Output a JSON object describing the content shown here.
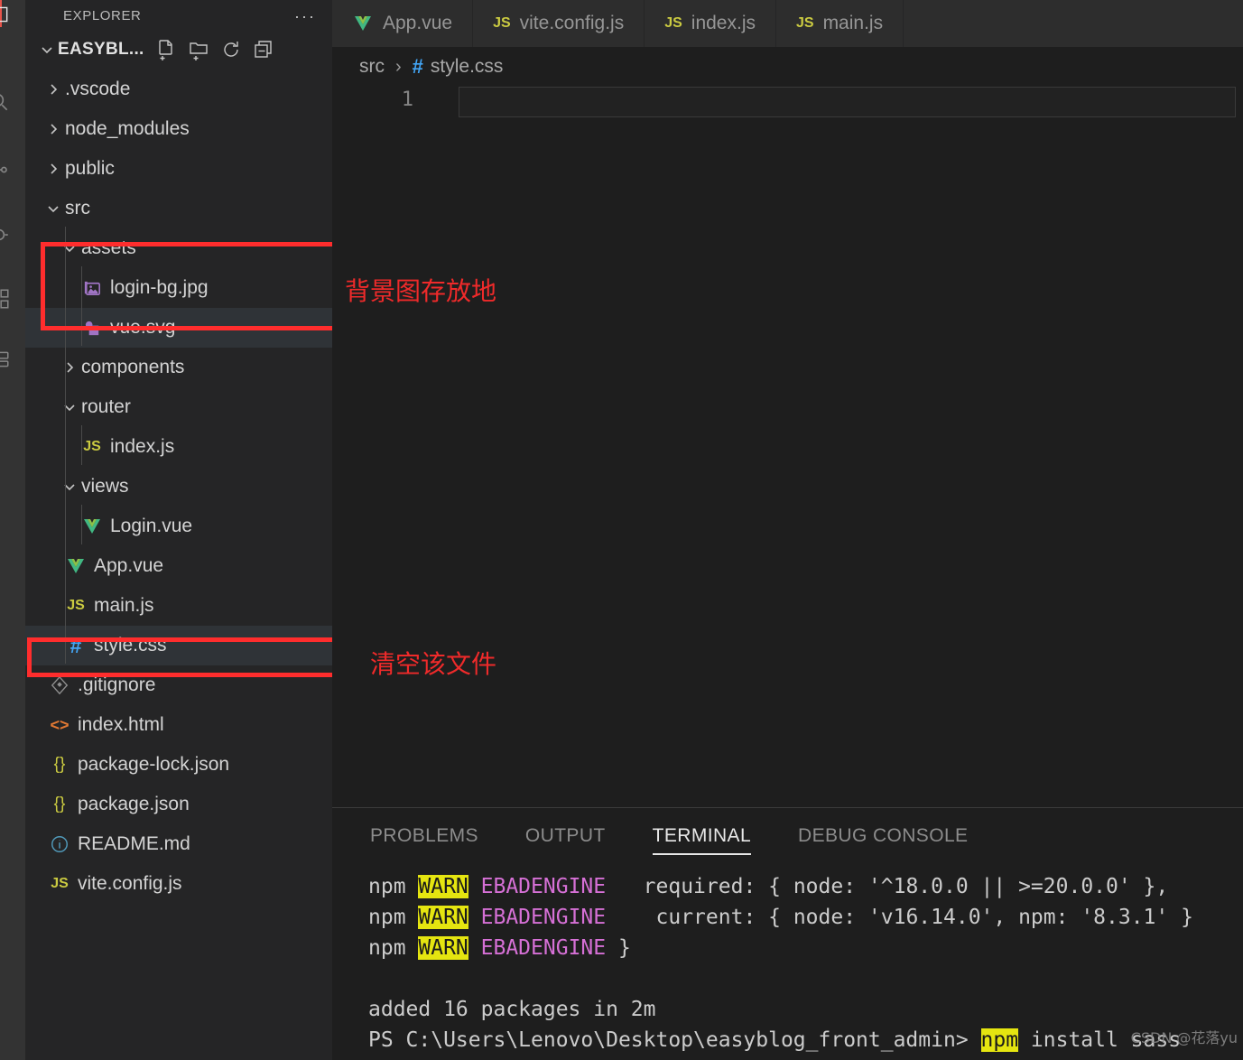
{
  "activity_bar": {
    "items": [
      {
        "name": "explorer-icon",
        "label": "Explorer"
      },
      {
        "name": "search-icon",
        "label": "Search"
      },
      {
        "name": "source-control-icon",
        "label": "Source Control"
      },
      {
        "name": "run-debug-icon",
        "label": "Run and Debug"
      },
      {
        "name": "extensions-icon",
        "label": "Extensions"
      },
      {
        "name": "remote-icon",
        "label": "Remote Explorer"
      }
    ],
    "accent_color": "#e7534a"
  },
  "sidebar": {
    "title": "EXPLORER",
    "more_actions": "···",
    "root_folder": "EASYBL...",
    "root_actions": [
      {
        "name": "new-file-icon",
        "label": "New File"
      },
      {
        "name": "new-folder-icon",
        "label": "New Folder"
      },
      {
        "name": "refresh-icon",
        "label": "Refresh Explorer"
      },
      {
        "name": "collapse-all-icon",
        "label": "Collapse Folders in Explorer"
      }
    ],
    "tree": [
      {
        "label": ".vscode",
        "kind": "folder",
        "state": "collapsed",
        "depth": 1,
        "icon": "chevron-right-icon"
      },
      {
        "label": "node_modules",
        "kind": "folder",
        "state": "collapsed",
        "depth": 1,
        "icon": "chevron-right-icon"
      },
      {
        "label": "public",
        "kind": "folder",
        "state": "collapsed",
        "depth": 1,
        "icon": "chevron-right-icon"
      },
      {
        "label": "src",
        "kind": "folder",
        "state": "expanded",
        "depth": 1,
        "icon": "chevron-down-icon"
      },
      {
        "label": "assets",
        "kind": "folder",
        "state": "expanded",
        "depth": 2,
        "icon": "chevron-down-icon"
      },
      {
        "label": "login-bg.jpg",
        "kind": "file",
        "ftype": "image",
        "depth": 3,
        "icon": "image-file-icon"
      },
      {
        "label": "vue.svg",
        "kind": "file",
        "ftype": "svg",
        "depth": 3,
        "icon": "svg-file-icon",
        "selected": true
      },
      {
        "label": "components",
        "kind": "folder",
        "state": "collapsed",
        "depth": 2,
        "icon": "chevron-right-icon"
      },
      {
        "label": "router",
        "kind": "folder",
        "state": "expanded",
        "depth": 2,
        "icon": "chevron-down-icon"
      },
      {
        "label": "index.js",
        "kind": "file",
        "ftype": "js",
        "depth": 3,
        "icon": "js-file-icon"
      },
      {
        "label": "views",
        "kind": "folder",
        "state": "expanded",
        "depth": 2,
        "icon": "chevron-down-icon"
      },
      {
        "label": "Login.vue",
        "kind": "file",
        "ftype": "vue",
        "depth": 3,
        "icon": "vue-file-icon"
      },
      {
        "label": "App.vue",
        "kind": "file",
        "ftype": "vue",
        "depth": 2,
        "icon": "vue-file-icon"
      },
      {
        "label": "main.js",
        "kind": "file",
        "ftype": "js",
        "depth": 2,
        "icon": "js-file-icon"
      },
      {
        "label": "style.css",
        "kind": "file",
        "ftype": "css",
        "depth": 2,
        "icon": "css-file-icon",
        "selected": true
      },
      {
        "label": ".gitignore",
        "kind": "file",
        "ftype": "git",
        "depth": 1,
        "icon": "git-file-icon"
      },
      {
        "label": "index.html",
        "kind": "file",
        "ftype": "html",
        "depth": 1,
        "icon": "html-file-icon"
      },
      {
        "label": "package-lock.json",
        "kind": "file",
        "ftype": "json",
        "depth": 1,
        "icon": "json-file-icon"
      },
      {
        "label": "package.json",
        "kind": "file",
        "ftype": "json",
        "depth": 1,
        "icon": "json-file-icon"
      },
      {
        "label": "README.md",
        "kind": "file",
        "ftype": "md",
        "depth": 1,
        "icon": "markdown-file-icon"
      },
      {
        "label": "vite.config.js",
        "kind": "file",
        "ftype": "js",
        "depth": 1,
        "icon": "js-file-icon"
      }
    ]
  },
  "annotations": {
    "color": "#ff2d2d",
    "notes": [
      {
        "text": "背景图存放地",
        "target": "assets-folder"
      },
      {
        "text": "清空该文件",
        "target": "style-css-file"
      }
    ]
  },
  "editor": {
    "tabs": [
      {
        "label": "App.vue",
        "ftype": "vue",
        "icon": "vue-file-icon"
      },
      {
        "label": "vite.config.js",
        "ftype": "js",
        "icon": "js-file-icon"
      },
      {
        "label": "index.js",
        "ftype": "js",
        "icon": "js-file-icon"
      },
      {
        "label": "main.js",
        "ftype": "js",
        "icon": "js-file-icon"
      }
    ],
    "breadcrumb": {
      "folder": "src",
      "separator": "›",
      "hash": "#",
      "file": "style.css"
    },
    "line_numbers": [
      "1"
    ],
    "content_lines": [
      ""
    ]
  },
  "panel": {
    "tabs": [
      {
        "label": "PROBLEMS",
        "active": false
      },
      {
        "label": "OUTPUT",
        "active": false
      },
      {
        "label": "TERMINAL",
        "active": true
      },
      {
        "label": "DEBUG CONSOLE",
        "active": false
      }
    ],
    "terminal_lines": [
      [
        {
          "text": "npm ",
          "style": "plain"
        },
        {
          "text": "WARN",
          "style": "warn"
        },
        {
          "text": " ",
          "style": "plain"
        },
        {
          "text": "EBADENGINE",
          "style": "magenta"
        },
        {
          "text": "   required: { node: '^18.0.0 || >=20.0.0' },",
          "style": "plain"
        }
      ],
      [
        {
          "text": "npm ",
          "style": "plain"
        },
        {
          "text": "WARN",
          "style": "warn"
        },
        {
          "text": " ",
          "style": "plain"
        },
        {
          "text": "EBADENGINE",
          "style": "magenta"
        },
        {
          "text": "    current: { node: 'v16.14.0', npm: '8.3.1' }",
          "style": "plain"
        }
      ],
      [
        {
          "text": "npm ",
          "style": "plain"
        },
        {
          "text": "WARN",
          "style": "warn"
        },
        {
          "text": " ",
          "style": "plain"
        },
        {
          "text": "EBADENGINE",
          "style": "magenta"
        },
        {
          "text": " }",
          "style": "plain"
        }
      ],
      [
        {
          "text": "",
          "style": "plain"
        }
      ],
      [
        {
          "text": "added 16 packages in 2m",
          "style": "plain"
        }
      ],
      [
        {
          "text": "PS C:\\Users\\Lenovo\\Desktop\\easyblog_front_admin> ",
          "style": "plain"
        },
        {
          "text": "npm",
          "style": "warn"
        },
        {
          "text": " install sass",
          "style": "plain"
        }
      ]
    ]
  },
  "watermark": "CSDN @花落yu"
}
